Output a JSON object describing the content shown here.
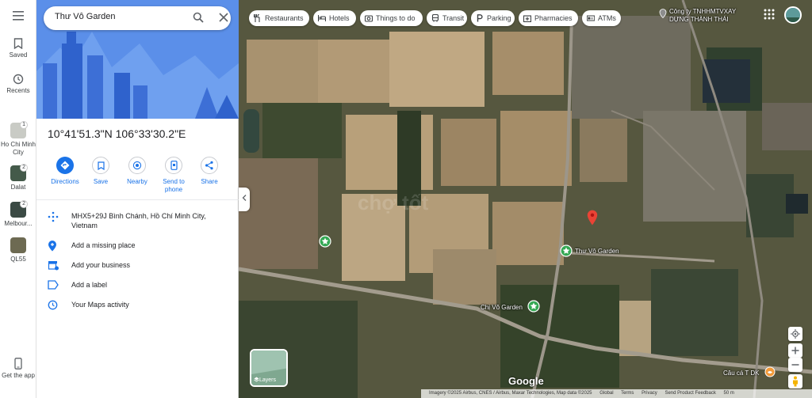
{
  "rail": {
    "saved": "Saved",
    "recents": "Recents",
    "recent_places": [
      {
        "label": "Ho Chi Minh City",
        "count": "1"
      },
      {
        "label": "Dalat",
        "count": "2"
      },
      {
        "label": "Melbour...",
        "count": "2"
      },
      {
        "label": "QL55",
        "count": ""
      }
    ],
    "get_app": "Get the app"
  },
  "search": {
    "value": "Thư Vô Garden"
  },
  "place": {
    "coordinates": "10°41'51.3\"N 106°33'30.2\"E",
    "actions": [
      "Directions",
      "Save",
      "Nearby",
      "Send to phone",
      "Share"
    ],
    "plus_code": "MHX5+29J Bình Chánh, Hồ Chí Minh City, Vietnam",
    "add_missing_place": "Add a missing place",
    "add_business": "Add your business",
    "add_label": "Add a label",
    "maps_activity": "Your Maps activity"
  },
  "map": {
    "chips": [
      "Restaurants",
      "Hotels",
      "Things to do",
      "Transit",
      "Parking",
      "Pharmacies",
      "ATMs"
    ],
    "labels": {
      "company": "Công ty TNHHMTVXAY",
      "company2": "DỰNG THÀNH THÁI",
      "garden1": "Thư Vô Garden",
      "garden2": "Chị Vô Garden",
      "fishing": "Câu cá T DK"
    },
    "layers": "Layers",
    "google": "Google",
    "footer": [
      "Imagery ©2025 Airbus, CNES / Airbus, Maxar Technologies, Map data ©2025",
      "Global",
      "Terms",
      "Privacy",
      "Send Product Feedback",
      "50 m"
    ],
    "colors": {
      "pin": "#ea4335",
      "accent": "#1a73e8",
      "hero": "#4f86e8",
      "poi": "#34a853"
    }
  }
}
